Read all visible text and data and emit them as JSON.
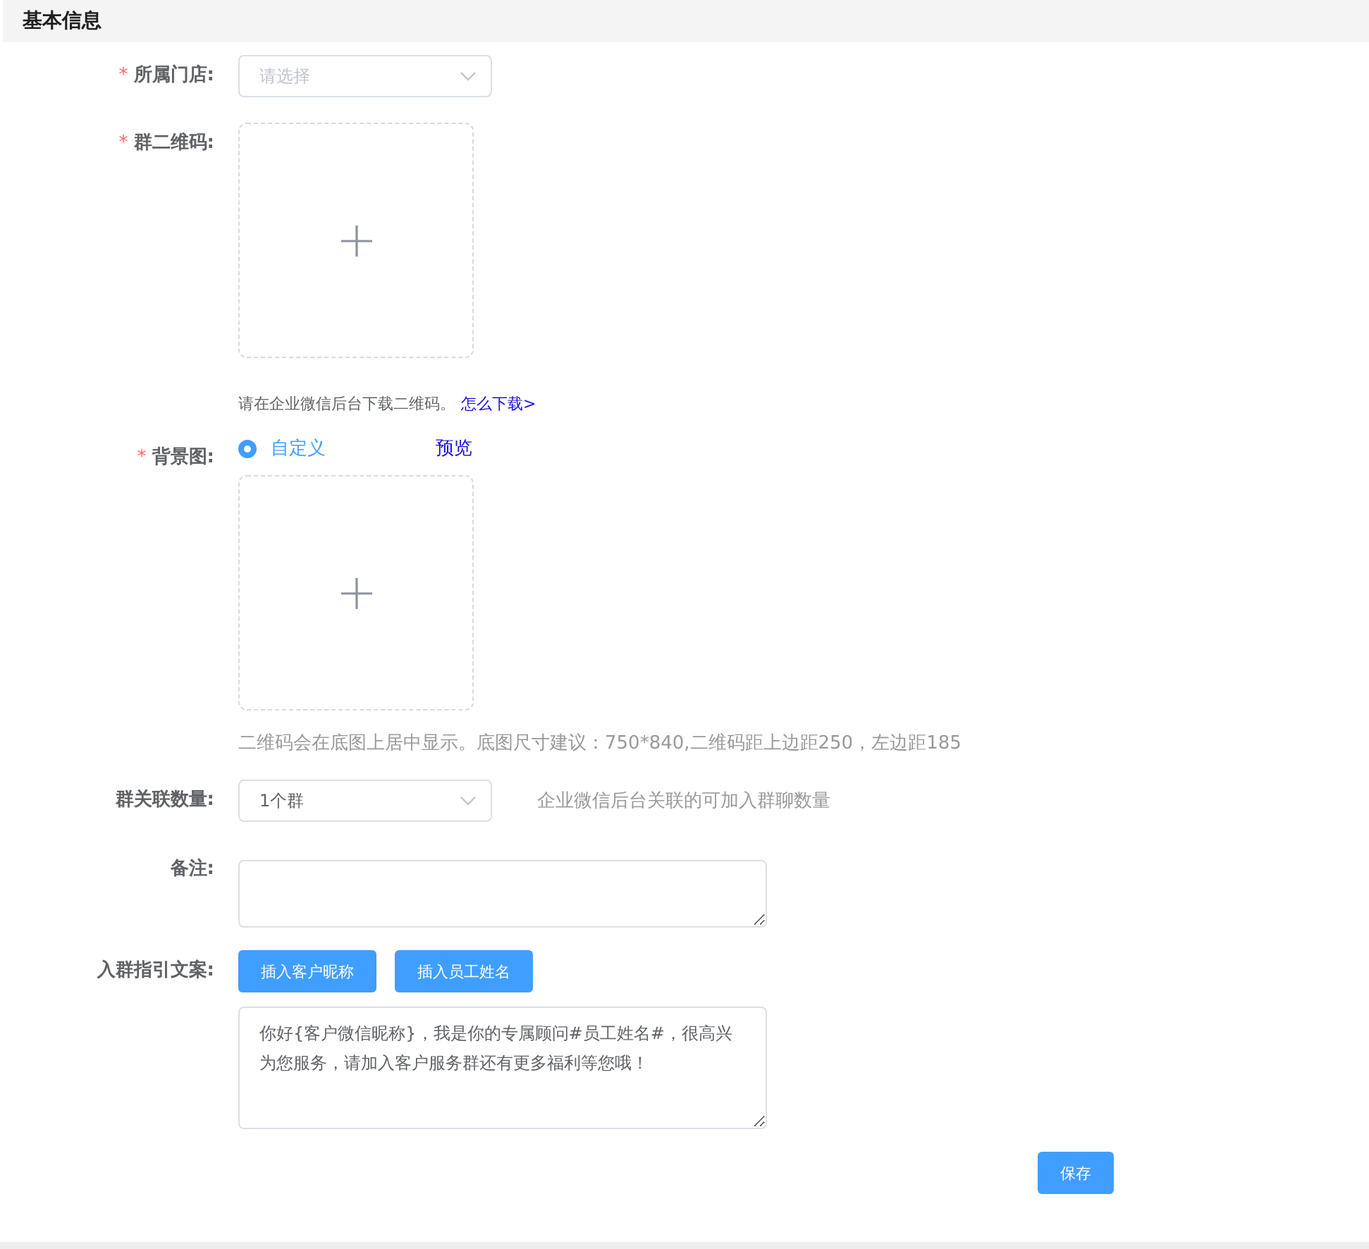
{
  "section": {
    "title": "基本信息"
  },
  "store": {
    "label": "所属门店:",
    "required_mark": "*",
    "placeholder": "请选择"
  },
  "qr_code": {
    "label": "群二维码:",
    "required_mark": "*",
    "hint": "请在企业微信后台下载二维码。",
    "link": "怎么下载>"
  },
  "background": {
    "label": "背景图:",
    "required_mark": "*",
    "options": [
      {
        "label": "自定义",
        "selected": true
      }
    ],
    "preview_link": "预览",
    "hint": "二维码会在底图上居中显示。底图尺寸建议：750*840,二维码距上边距250，左边距185"
  },
  "group_count": {
    "label": "群关联数量:",
    "value": "1个群",
    "hint": "企业微信后台关联的可加入群聊数量"
  },
  "remark": {
    "label": "备注:"
  },
  "guide": {
    "label": "入群指引文案:",
    "buttons": [
      "插入客户昵称",
      "插入员工姓名"
    ],
    "value": "你好{客户微信昵称}，我是你的专属顾问#员工姓名#，很高兴为您服务，请加入客户服务群还有更多福利等您哦！"
  },
  "save_button": "保存"
}
